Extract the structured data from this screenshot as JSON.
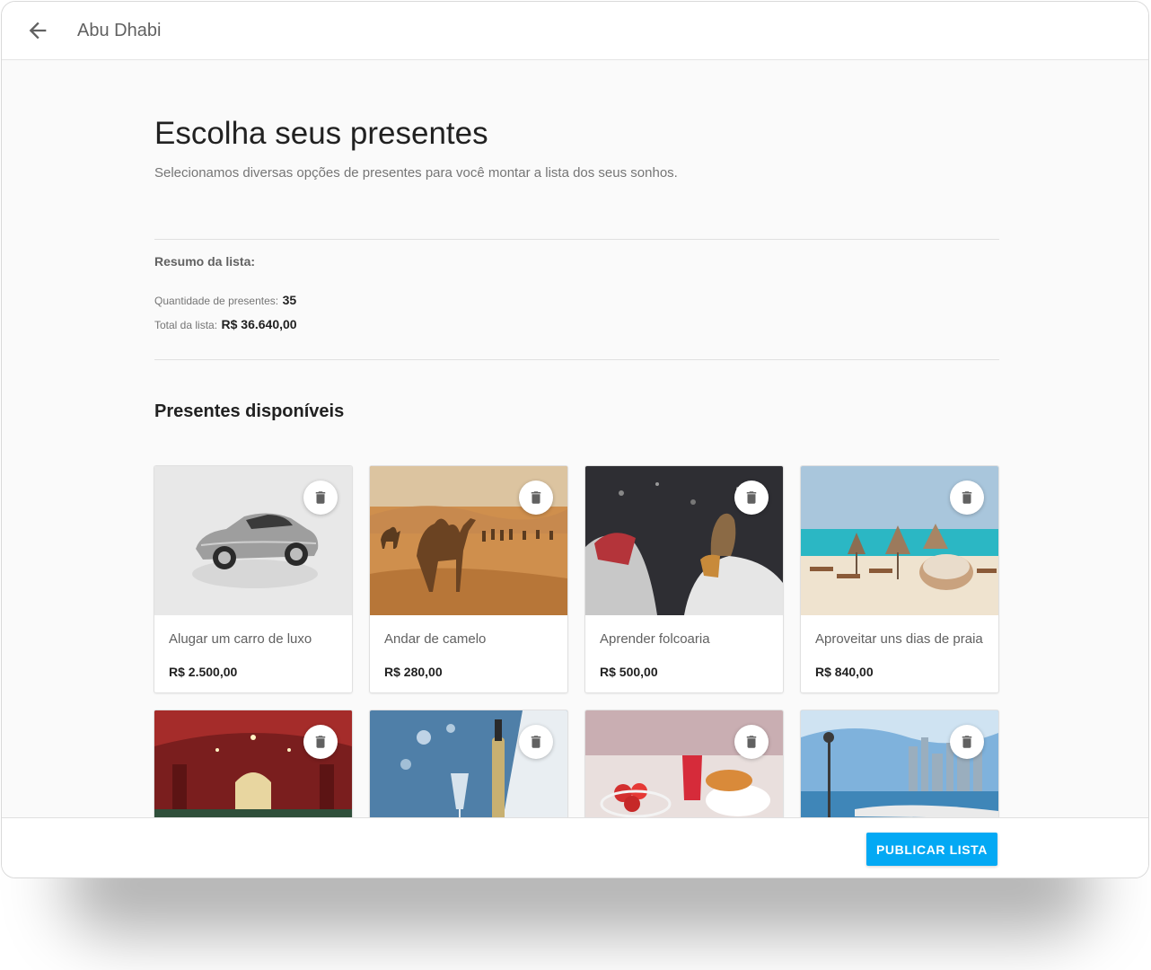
{
  "topbar": {
    "title": "Abu Dhabi",
    "back_icon": "arrow-back-icon"
  },
  "header": {
    "title": "Escolha seus presentes",
    "subtitle": "Selecionamos diversas opções de presentes para você montar a lista dos seus sonhos."
  },
  "summary": {
    "label": "Resumo da lista:",
    "quantity_label": "Quantidade de presentes:",
    "quantity_value": "35",
    "total_label": "Total da lista:",
    "total_value": "R$ 36.640,00"
  },
  "gifts_section": {
    "title": "Presentes disponíveis",
    "delete_icon": "trash-icon",
    "items": [
      {
        "name": "Alugar um carro de luxo",
        "price": "R$ 2.500,00",
        "image": "luxury-car"
      },
      {
        "name": "Andar de camelo",
        "price": "R$ 280,00",
        "image": "camel-desert"
      },
      {
        "name": "Aprender folcoaria",
        "price": "R$ 500,00",
        "image": "falconry"
      },
      {
        "name": "Aproveitar uns dias de praia",
        "price": "R$ 840,00",
        "image": "beach"
      },
      {
        "name": "",
        "price": "",
        "image": "hammam"
      },
      {
        "name": "",
        "price": "",
        "image": "champagne-yacht"
      },
      {
        "name": "",
        "price": "",
        "image": "breakfast"
      },
      {
        "name": "",
        "price": "",
        "image": "city-skyline"
      }
    ]
  },
  "footer": {
    "publish_label": "PUBLICAR LISTA"
  },
  "colors": {
    "accent": "#03a9f4",
    "background": "#fafafa"
  }
}
